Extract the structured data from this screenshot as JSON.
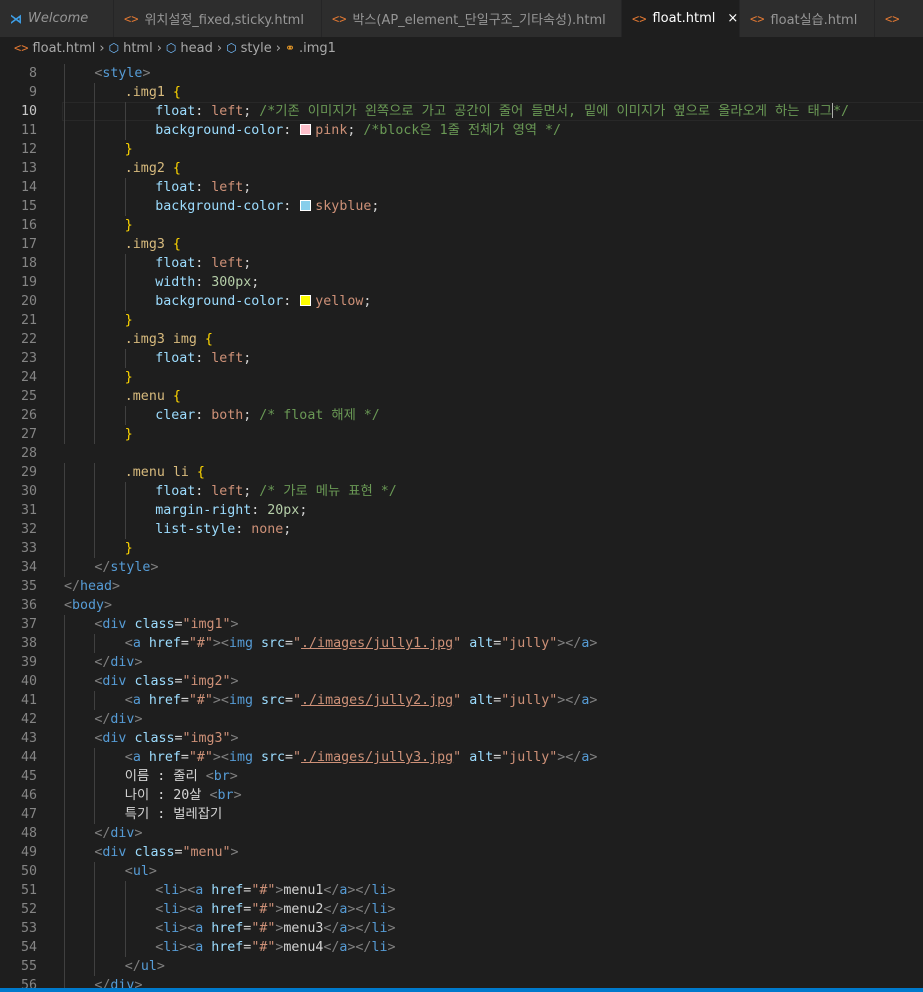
{
  "tabs": [
    {
      "label": "Welcome",
      "icon": "vscode-logo-icon",
      "italic": true,
      "active": false
    },
    {
      "label": "위치설정_fixed,sticky.html",
      "icon": "html-file-icon",
      "active": false
    },
    {
      "label": "박스(AP_element_단일구조_기타속성).html",
      "icon": "html-file-icon",
      "active": false
    },
    {
      "label": "float.html",
      "icon": "html-file-icon",
      "active": true,
      "close": "×"
    },
    {
      "label": "float실습.html",
      "icon": "html-file-icon",
      "active": false
    },
    {
      "label": "",
      "icon": "html-file-icon",
      "active": false
    }
  ],
  "breadcrumb": [
    {
      "label": "float.html",
      "icon": "html-file-icon"
    },
    {
      "label": "html",
      "icon": "cube-icon"
    },
    {
      "label": "head",
      "icon": "cube-icon"
    },
    {
      "label": "style",
      "icon": "cube-icon"
    },
    {
      "label": ".img1",
      "icon": "selector-icon"
    }
  ],
  "current_line": 10,
  "colors": {
    "pink": "#ffc0cb",
    "skyblue": "#87ceeb",
    "yellow": "#ffff00",
    "accent": "#007acc"
  },
  "lines": [
    {
      "n": 8,
      "indent": 1,
      "tokens": [
        [
          "t-punc",
          "<"
        ],
        [
          "t-tag",
          "style"
        ],
        [
          "t-punc",
          ">"
        ]
      ]
    },
    {
      "n": 9,
      "indent": 2,
      "tokens": [
        [
          "t-sel",
          ".img1 "
        ],
        [
          "t-br",
          "{"
        ]
      ]
    },
    {
      "n": 10,
      "indent": 3,
      "tokens": [
        [
          "t-prop",
          "float"
        ],
        [
          "t-txt",
          ": "
        ],
        [
          "t-val",
          "left"
        ],
        [
          "t-txt",
          "; "
        ],
        [
          "t-com",
          "/*기존 이미지가 왼쪽으로 가고 공간이 줄어 들면서, 밑에 이미지가 옆으로 올라오게 하는 태그"
        ],
        [
          "caret",
          ""
        ],
        [
          "t-com",
          "*/"
        ]
      ]
    },
    {
      "n": 11,
      "indent": 3,
      "tokens": [
        [
          "t-prop",
          "background-color"
        ],
        [
          "t-txt",
          ": "
        ],
        [
          "swatch",
          "pink"
        ],
        [
          "t-val",
          "pink"
        ],
        [
          "t-txt",
          "; "
        ],
        [
          "t-com",
          "/*block은 1줄 전체가 영역 */"
        ]
      ]
    },
    {
      "n": 12,
      "indent": 2,
      "tokens": [
        [
          "t-br",
          "}"
        ]
      ]
    },
    {
      "n": 13,
      "indent": 2,
      "tokens": [
        [
          "t-sel",
          ".img2 "
        ],
        [
          "t-br",
          "{"
        ]
      ]
    },
    {
      "n": 14,
      "indent": 3,
      "tokens": [
        [
          "t-prop",
          "float"
        ],
        [
          "t-txt",
          ": "
        ],
        [
          "t-val",
          "left"
        ],
        [
          "t-txt",
          ";"
        ]
      ]
    },
    {
      "n": 15,
      "indent": 3,
      "tokens": [
        [
          "t-prop",
          "background-color"
        ],
        [
          "t-txt",
          ": "
        ],
        [
          "swatch",
          "skyblue"
        ],
        [
          "t-val",
          "skyblue"
        ],
        [
          "t-txt",
          ";"
        ]
      ]
    },
    {
      "n": 16,
      "indent": 2,
      "tokens": [
        [
          "t-br",
          "}"
        ]
      ]
    },
    {
      "n": 17,
      "indent": 2,
      "tokens": [
        [
          "t-sel",
          ".img3 "
        ],
        [
          "t-br",
          "{"
        ]
      ]
    },
    {
      "n": 18,
      "indent": 3,
      "tokens": [
        [
          "t-prop",
          "float"
        ],
        [
          "t-txt",
          ": "
        ],
        [
          "t-val",
          "left"
        ],
        [
          "t-txt",
          ";"
        ]
      ]
    },
    {
      "n": 19,
      "indent": 3,
      "tokens": [
        [
          "t-prop",
          "width"
        ],
        [
          "t-txt",
          ": "
        ],
        [
          "t-num",
          "300px"
        ],
        [
          "t-txt",
          ";"
        ]
      ]
    },
    {
      "n": 20,
      "indent": 3,
      "tokens": [
        [
          "t-prop",
          "background-color"
        ],
        [
          "t-txt",
          ": "
        ],
        [
          "swatch",
          "yellow"
        ],
        [
          "t-val",
          "yellow"
        ],
        [
          "t-txt",
          ";"
        ]
      ]
    },
    {
      "n": 21,
      "indent": 2,
      "tokens": [
        [
          "t-br",
          "}"
        ]
      ]
    },
    {
      "n": 22,
      "indent": 2,
      "tokens": [
        [
          "t-sel",
          ".img3 img "
        ],
        [
          "t-br",
          "{"
        ]
      ]
    },
    {
      "n": 23,
      "indent": 3,
      "tokens": [
        [
          "t-prop",
          "float"
        ],
        [
          "t-txt",
          ": "
        ],
        [
          "t-val",
          "left"
        ],
        [
          "t-txt",
          ";"
        ]
      ]
    },
    {
      "n": 24,
      "indent": 2,
      "tokens": [
        [
          "t-br",
          "}"
        ]
      ]
    },
    {
      "n": 25,
      "indent": 2,
      "tokens": [
        [
          "t-sel",
          ".menu "
        ],
        [
          "t-br",
          "{"
        ]
      ]
    },
    {
      "n": 26,
      "indent": 3,
      "tokens": [
        [
          "t-prop",
          "clear"
        ],
        [
          "t-txt",
          ": "
        ],
        [
          "t-val",
          "both"
        ],
        [
          "t-txt",
          "; "
        ],
        [
          "t-com",
          "/* float 해제 */"
        ]
      ]
    },
    {
      "n": 27,
      "indent": 2,
      "tokens": [
        [
          "t-br",
          "}"
        ]
      ]
    },
    {
      "n": 28,
      "indent": 0,
      "tokens": []
    },
    {
      "n": 29,
      "indent": 2,
      "tokens": [
        [
          "t-sel",
          ".menu li "
        ],
        [
          "t-br",
          "{"
        ]
      ]
    },
    {
      "n": 30,
      "indent": 3,
      "tokens": [
        [
          "t-prop",
          "float"
        ],
        [
          "t-txt",
          ": "
        ],
        [
          "t-val",
          "left"
        ],
        [
          "t-txt",
          "; "
        ],
        [
          "t-com",
          "/* 가로 메뉴 표현 */"
        ]
      ]
    },
    {
      "n": 31,
      "indent": 3,
      "tokens": [
        [
          "t-prop",
          "margin-right"
        ],
        [
          "t-txt",
          ": "
        ],
        [
          "t-num",
          "20px"
        ],
        [
          "t-txt",
          ";"
        ]
      ]
    },
    {
      "n": 32,
      "indent": 3,
      "tokens": [
        [
          "t-prop",
          "list-style"
        ],
        [
          "t-txt",
          ": "
        ],
        [
          "t-val",
          "none"
        ],
        [
          "t-txt",
          ";"
        ]
      ]
    },
    {
      "n": 33,
      "indent": 2,
      "tokens": [
        [
          "t-br",
          "}"
        ]
      ]
    },
    {
      "n": 34,
      "indent": 1,
      "tokens": [
        [
          "t-punc",
          "</"
        ],
        [
          "t-tag",
          "style"
        ],
        [
          "t-punc",
          ">"
        ]
      ]
    },
    {
      "n": 35,
      "indent": 0,
      "tokens": [
        [
          "t-punc",
          "</"
        ],
        [
          "t-tag",
          "head"
        ],
        [
          "t-punc",
          ">"
        ]
      ]
    },
    {
      "n": 36,
      "indent": 0,
      "tokens": [
        [
          "t-punc",
          "<"
        ],
        [
          "t-tag",
          "body"
        ],
        [
          "t-punc",
          ">"
        ]
      ]
    },
    {
      "n": 37,
      "indent": 1,
      "tokens": [
        [
          "t-punc",
          "<"
        ],
        [
          "t-tag",
          "div"
        ],
        [
          "t-txt",
          " "
        ],
        [
          "t-attr",
          "class"
        ],
        [
          "t-txt",
          "="
        ],
        [
          "t-str",
          "\"img1\""
        ],
        [
          "t-punc",
          ">"
        ]
      ]
    },
    {
      "n": 38,
      "indent": 2,
      "tokens": [
        [
          "t-punc",
          "<"
        ],
        [
          "t-tag",
          "a"
        ],
        [
          "t-txt",
          " "
        ],
        [
          "t-attr",
          "href"
        ],
        [
          "t-txt",
          "="
        ],
        [
          "t-str",
          "\"#\""
        ],
        [
          "t-punc",
          "><"
        ],
        [
          "t-tag",
          "img"
        ],
        [
          "t-txt",
          " "
        ],
        [
          "t-attr",
          "src"
        ],
        [
          "t-txt",
          "="
        ],
        [
          "t-str",
          "\""
        ],
        [
          "t-url",
          "./images/jully1.jpg"
        ],
        [
          "t-str",
          "\""
        ],
        [
          "t-txt",
          " "
        ],
        [
          "t-attr",
          "alt"
        ],
        [
          "t-txt",
          "="
        ],
        [
          "t-str",
          "\"jully\""
        ],
        [
          "t-punc",
          "></"
        ],
        [
          "t-tag",
          "a"
        ],
        [
          "t-punc",
          ">"
        ]
      ]
    },
    {
      "n": 39,
      "indent": 1,
      "tokens": [
        [
          "t-punc",
          "</"
        ],
        [
          "t-tag",
          "div"
        ],
        [
          "t-punc",
          ">"
        ]
      ]
    },
    {
      "n": 40,
      "indent": 1,
      "tokens": [
        [
          "t-punc",
          "<"
        ],
        [
          "t-tag",
          "div"
        ],
        [
          "t-txt",
          " "
        ],
        [
          "t-attr",
          "class"
        ],
        [
          "t-txt",
          "="
        ],
        [
          "t-str",
          "\"img2\""
        ],
        [
          "t-punc",
          ">"
        ]
      ]
    },
    {
      "n": 41,
      "indent": 2,
      "tokens": [
        [
          "t-punc",
          "<"
        ],
        [
          "t-tag",
          "a"
        ],
        [
          "t-txt",
          " "
        ],
        [
          "t-attr",
          "href"
        ],
        [
          "t-txt",
          "="
        ],
        [
          "t-str",
          "\"#\""
        ],
        [
          "t-punc",
          "><"
        ],
        [
          "t-tag",
          "img"
        ],
        [
          "t-txt",
          " "
        ],
        [
          "t-attr",
          "src"
        ],
        [
          "t-txt",
          "="
        ],
        [
          "t-str",
          "\""
        ],
        [
          "t-url",
          "./images/jully2.jpg"
        ],
        [
          "t-str",
          "\""
        ],
        [
          "t-txt",
          " "
        ],
        [
          "t-attr",
          "alt"
        ],
        [
          "t-txt",
          "="
        ],
        [
          "t-str",
          "\"jully\""
        ],
        [
          "t-punc",
          "></"
        ],
        [
          "t-tag",
          "a"
        ],
        [
          "t-punc",
          ">"
        ]
      ]
    },
    {
      "n": 42,
      "indent": 1,
      "tokens": [
        [
          "t-punc",
          "</"
        ],
        [
          "t-tag",
          "div"
        ],
        [
          "t-punc",
          ">"
        ]
      ]
    },
    {
      "n": 43,
      "indent": 1,
      "tokens": [
        [
          "t-punc",
          "<"
        ],
        [
          "t-tag",
          "div"
        ],
        [
          "t-txt",
          " "
        ],
        [
          "t-attr",
          "class"
        ],
        [
          "t-txt",
          "="
        ],
        [
          "t-str",
          "\"img3\""
        ],
        [
          "t-punc",
          ">"
        ]
      ]
    },
    {
      "n": 44,
      "indent": 2,
      "tokens": [
        [
          "t-punc",
          "<"
        ],
        [
          "t-tag",
          "a"
        ],
        [
          "t-txt",
          " "
        ],
        [
          "t-attr",
          "href"
        ],
        [
          "t-txt",
          "="
        ],
        [
          "t-str",
          "\"#\""
        ],
        [
          "t-punc",
          "><"
        ],
        [
          "t-tag",
          "img"
        ],
        [
          "t-txt",
          " "
        ],
        [
          "t-attr",
          "src"
        ],
        [
          "t-txt",
          "="
        ],
        [
          "t-str",
          "\""
        ],
        [
          "t-url",
          "./images/jully3.jpg"
        ],
        [
          "t-str",
          "\""
        ],
        [
          "t-txt",
          " "
        ],
        [
          "t-attr",
          "alt"
        ],
        [
          "t-txt",
          "="
        ],
        [
          "t-str",
          "\"jully\""
        ],
        [
          "t-punc",
          "></"
        ],
        [
          "t-tag",
          "a"
        ],
        [
          "t-punc",
          ">"
        ]
      ]
    },
    {
      "n": 45,
      "indent": 2,
      "tokens": [
        [
          "t-txt",
          "이름 : 줄리 "
        ],
        [
          "t-punc",
          "<"
        ],
        [
          "t-tag",
          "br"
        ],
        [
          "t-punc",
          ">"
        ]
      ]
    },
    {
      "n": 46,
      "indent": 2,
      "tokens": [
        [
          "t-txt",
          "나이 : 20살 "
        ],
        [
          "t-punc",
          "<"
        ],
        [
          "t-tag",
          "br"
        ],
        [
          "t-punc",
          ">"
        ]
      ]
    },
    {
      "n": 47,
      "indent": 2,
      "tokens": [
        [
          "t-txt",
          "특기 : 벌레잡기"
        ]
      ]
    },
    {
      "n": 48,
      "indent": 1,
      "tokens": [
        [
          "t-punc",
          "</"
        ],
        [
          "t-tag",
          "div"
        ],
        [
          "t-punc",
          ">"
        ]
      ]
    },
    {
      "n": 49,
      "indent": 1,
      "tokens": [
        [
          "t-punc",
          "<"
        ],
        [
          "t-tag",
          "div"
        ],
        [
          "t-txt",
          " "
        ],
        [
          "t-attr",
          "class"
        ],
        [
          "t-txt",
          "="
        ],
        [
          "t-str",
          "\"menu\""
        ],
        [
          "t-punc",
          ">"
        ]
      ]
    },
    {
      "n": 50,
      "indent": 2,
      "tokens": [
        [
          "t-punc",
          "<"
        ],
        [
          "t-tag",
          "ul"
        ],
        [
          "t-punc",
          ">"
        ]
      ]
    },
    {
      "n": 51,
      "indent": 3,
      "tokens": [
        [
          "t-punc",
          "<"
        ],
        [
          "t-tag",
          "li"
        ],
        [
          "t-punc",
          "><"
        ],
        [
          "t-tag",
          "a"
        ],
        [
          "t-txt",
          " "
        ],
        [
          "t-attr",
          "href"
        ],
        [
          "t-txt",
          "="
        ],
        [
          "t-str",
          "\"#\""
        ],
        [
          "t-punc",
          ">"
        ],
        [
          "t-txt",
          "menu1"
        ],
        [
          "t-punc",
          "</"
        ],
        [
          "t-tag",
          "a"
        ],
        [
          "t-punc",
          "></"
        ],
        [
          "t-tag",
          "li"
        ],
        [
          "t-punc",
          ">"
        ]
      ]
    },
    {
      "n": 52,
      "indent": 3,
      "tokens": [
        [
          "t-punc",
          "<"
        ],
        [
          "t-tag",
          "li"
        ],
        [
          "t-punc",
          "><"
        ],
        [
          "t-tag",
          "a"
        ],
        [
          "t-txt",
          " "
        ],
        [
          "t-attr",
          "href"
        ],
        [
          "t-txt",
          "="
        ],
        [
          "t-str",
          "\"#\""
        ],
        [
          "t-punc",
          ">"
        ],
        [
          "t-txt",
          "menu2"
        ],
        [
          "t-punc",
          "</"
        ],
        [
          "t-tag",
          "a"
        ],
        [
          "t-punc",
          "></"
        ],
        [
          "t-tag",
          "li"
        ],
        [
          "t-punc",
          ">"
        ]
      ]
    },
    {
      "n": 53,
      "indent": 3,
      "tokens": [
        [
          "t-punc",
          "<"
        ],
        [
          "t-tag",
          "li"
        ],
        [
          "t-punc",
          "><"
        ],
        [
          "t-tag",
          "a"
        ],
        [
          "t-txt",
          " "
        ],
        [
          "t-attr",
          "href"
        ],
        [
          "t-txt",
          "="
        ],
        [
          "t-str",
          "\"#\""
        ],
        [
          "t-punc",
          ">"
        ],
        [
          "t-txt",
          "menu3"
        ],
        [
          "t-punc",
          "</"
        ],
        [
          "t-tag",
          "a"
        ],
        [
          "t-punc",
          "></"
        ],
        [
          "t-tag",
          "li"
        ],
        [
          "t-punc",
          ">"
        ]
      ]
    },
    {
      "n": 54,
      "indent": 3,
      "tokens": [
        [
          "t-punc",
          "<"
        ],
        [
          "t-tag",
          "li"
        ],
        [
          "t-punc",
          "><"
        ],
        [
          "t-tag",
          "a"
        ],
        [
          "t-txt",
          " "
        ],
        [
          "t-attr",
          "href"
        ],
        [
          "t-txt",
          "="
        ],
        [
          "t-str",
          "\"#\""
        ],
        [
          "t-punc",
          ">"
        ],
        [
          "t-txt",
          "menu4"
        ],
        [
          "t-punc",
          "</"
        ],
        [
          "t-tag",
          "a"
        ],
        [
          "t-punc",
          "></"
        ],
        [
          "t-tag",
          "li"
        ],
        [
          "t-punc",
          ">"
        ]
      ]
    },
    {
      "n": 55,
      "indent": 2,
      "tokens": [
        [
          "t-punc",
          "</"
        ],
        [
          "t-tag",
          "ul"
        ],
        [
          "t-punc",
          ">"
        ]
      ]
    },
    {
      "n": 56,
      "indent": 1,
      "tokens": [
        [
          "t-punc",
          "</"
        ],
        [
          "t-tag",
          "div"
        ],
        [
          "t-punc",
          ">"
        ]
      ]
    }
  ]
}
